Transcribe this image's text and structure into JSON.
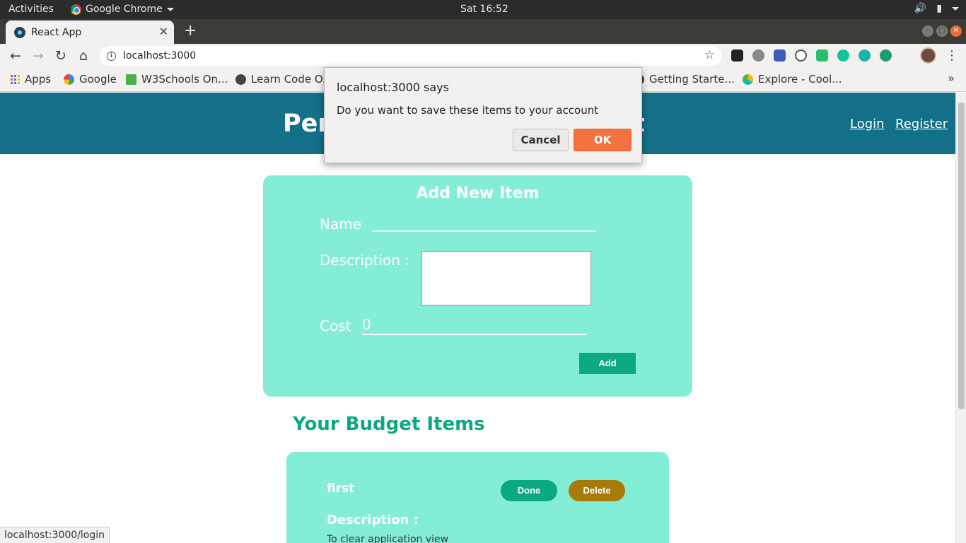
{
  "system_bar": {
    "activities": "Activities",
    "app_name": "Google Chrome",
    "clock": "Sat 16:52"
  },
  "browser": {
    "tab_title": "React App",
    "url": "localhost:3000",
    "bookmarks": [
      {
        "label": "Apps"
      },
      {
        "label": "Google"
      },
      {
        "label": "W3Schools On..."
      },
      {
        "label": "Learn Code O..."
      },
      {
        "label": "Getting Starte..."
      },
      {
        "label": "Explore - Cool..."
      }
    ],
    "status_url": "localhost:3000/login"
  },
  "header": {
    "title_left": "Per",
    "title_right": "nt",
    "login": "Login",
    "register": "Register"
  },
  "add_form": {
    "title": "Add New Item",
    "name_label": "Name",
    "name_value": "",
    "description_label": "Description :",
    "description_value": "",
    "cost_label": "Cost",
    "cost_value": "0",
    "add_button": "Add"
  },
  "budget": {
    "section_title": "Your Budget Items",
    "items": [
      {
        "name": "first",
        "done_label": "Done",
        "delete_label": "Delete",
        "description_label": "Description :",
        "description": "To clear application view"
      }
    ]
  },
  "dialog": {
    "title": "localhost:3000 says",
    "message": "Do you want to save these items to your account",
    "cancel": "Cancel",
    "ok": "OK"
  },
  "colors": {
    "header_bg": "#147088",
    "card_bg": "#84edd6",
    "accent_green": "#0ba884",
    "delete_brown": "#a87b08",
    "ok_orange": "#f47140"
  }
}
